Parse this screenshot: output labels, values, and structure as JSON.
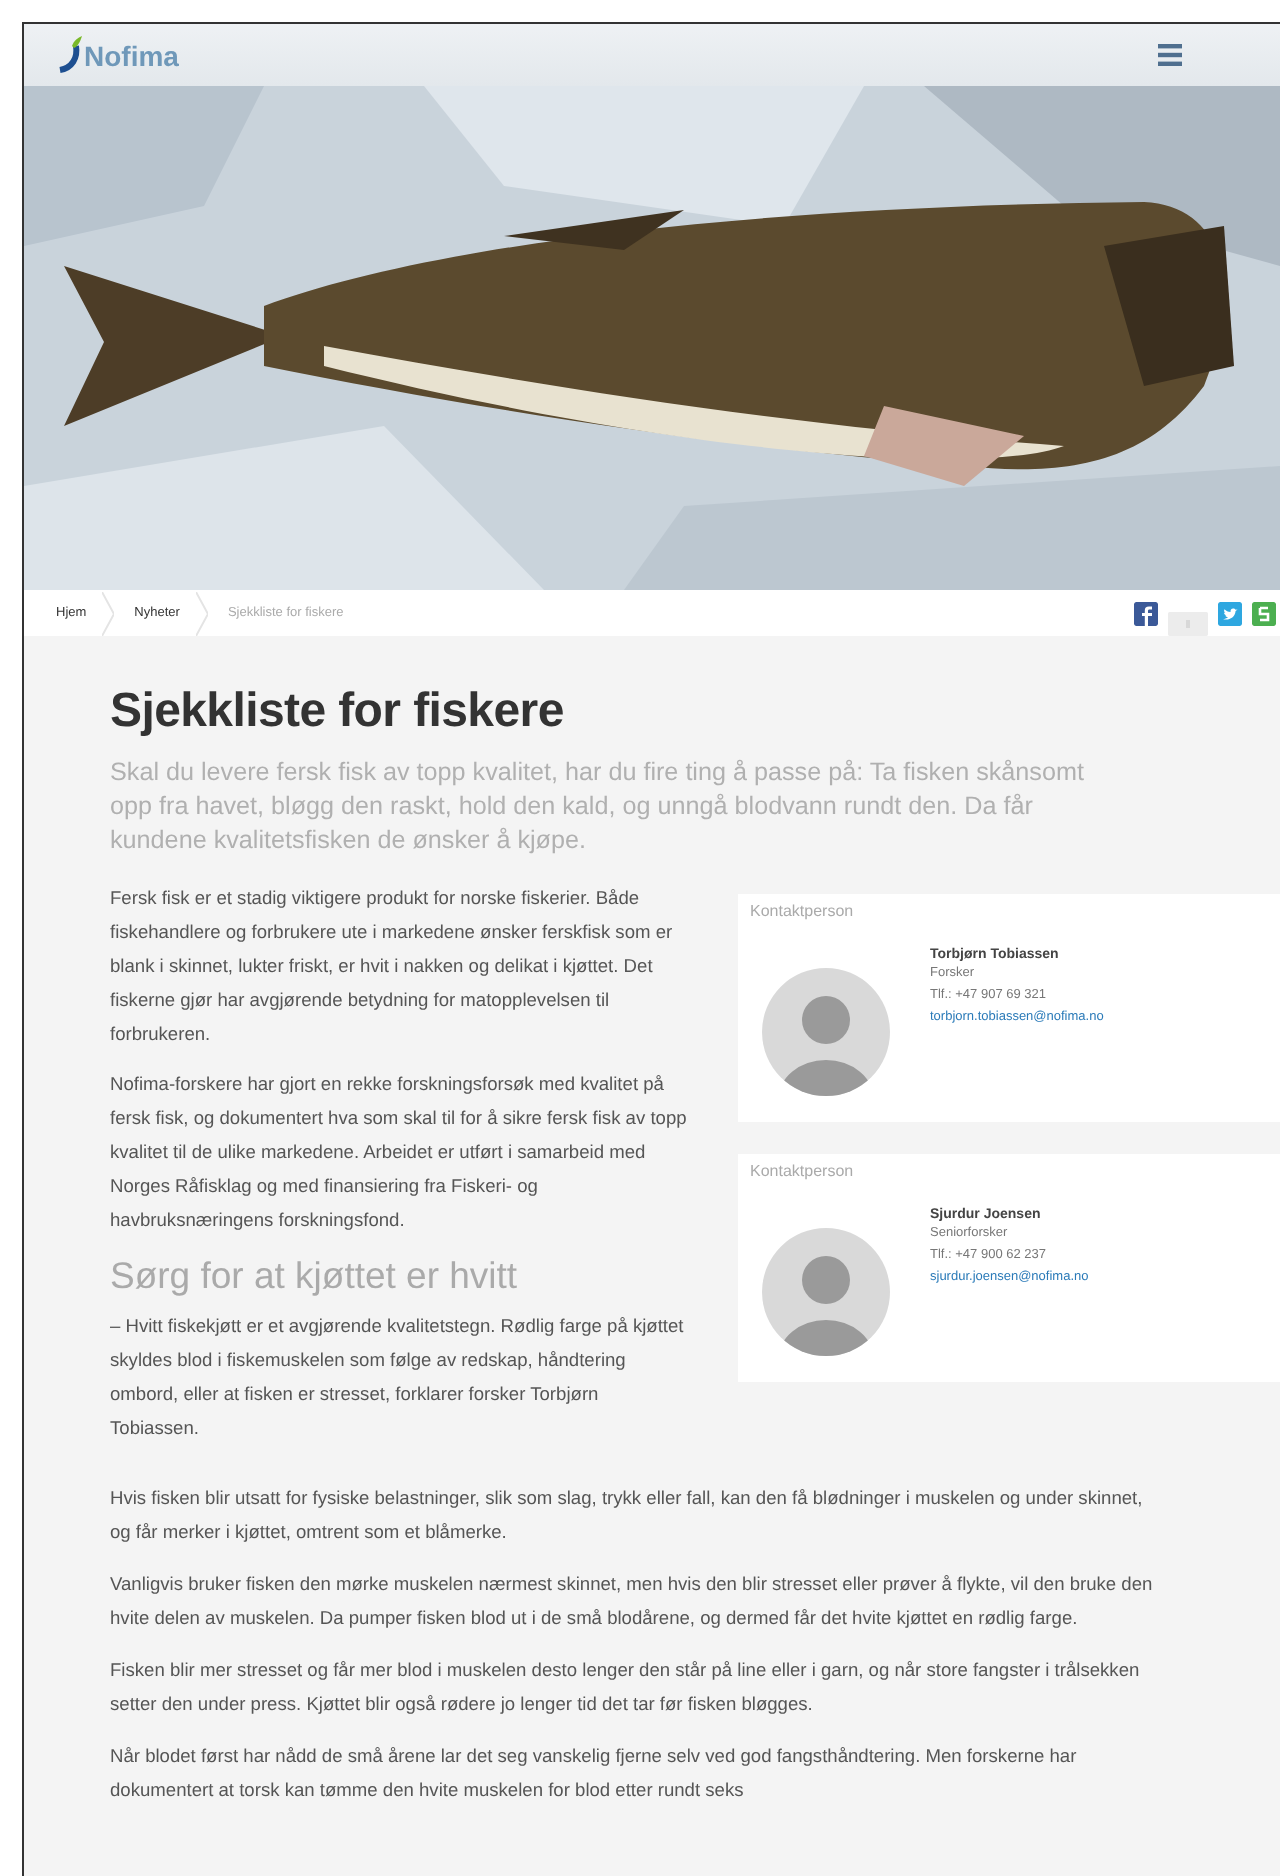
{
  "header": {
    "logo": "Nofima"
  },
  "breadcrumb": [
    {
      "label": "Hjem",
      "current": false
    },
    {
      "label": "Nyheter",
      "current": false
    },
    {
      "label": "Sjekkliste for fiskere",
      "current": true
    }
  ],
  "share": [
    {
      "kind": "facebook"
    },
    {
      "kind": "blank"
    },
    {
      "kind": "twitter"
    },
    {
      "kind": "share"
    }
  ],
  "article": {
    "title": "Sjekkliste for fiskere",
    "lead": "Skal du levere fersk fisk av topp kvalitet, har du fire ting å passe på: Ta fisken skånsomt opp fra havet, bløgg den raskt, hold den kald, og unngå blodvann rundt den. Da får kundene kvalitetsfisken de ønsker å kjøpe.",
    "column_blocks": [
      {
        "kind": "p",
        "text": "Fersk fisk er et stadig viktigere produkt for norske fiskerier. Både fiskehandlere og forbrukere ute i markedene ønsker ferskfisk som er blank i skinnet, lukter friskt, er hvit i nakken og delikat i kjøttet. Det fiskerne gjør har avgjørende betydning for matopplevelsen til forbrukeren."
      },
      {
        "kind": "p",
        "text": "Nofima-forskere har gjort en rekke forskningsforsøk med kvalitet på fersk fisk, og dokumentert hva som skal til for å sikre fersk fisk av topp kvalitet til de ulike markedene. Arbeidet er utført i samarbeid med Norges Råfisklag og med finansiering fra Fiskeri- og havbruksnæringens forskningsfond."
      },
      {
        "kind": "h2",
        "text": "Sørg for at kjøttet er hvitt"
      },
      {
        "kind": "p",
        "text": "– Hvitt fiskekjøtt er et avgjørende kvalitetstegn. Rødlig farge på kjøttet skyldes blod i fiskemuskelen som følge av redskap, håndtering ombord, eller at fisken er stresset, forklarer forsker Torbjørn Tobiassen."
      }
    ],
    "wide_paragraphs": [
      "Hvis fisken blir utsatt for fysiske belastninger, slik som slag, trykk eller fall, kan den få blødninger i muskelen og under skinnet, og får merker i kjøttet, omtrent som et blåmerke.",
      "Vanligvis bruker fisken den mørke muskelen nærmest skinnet, men hvis den blir stresset eller prøver å flykte, vil den bruke den hvite delen av muskelen. Da pumper fisken blod ut i de små blodårene, og dermed får det hvite kjøttet en rødlig farge.",
      "Fisken blir mer stresset og får mer blod i muskelen desto lenger den står på line eller i garn, og når store fangster i trålsekken setter den under press. Kjøttet blir også rødere jo lenger tid det tar før fisken bløgges.",
      "Når blodet først har nådd de små årene lar det seg vanskelig fjerne selv ved god fangsthåndtering. Men forskerne har dokumentert at torsk kan tømme den hvite muskelen for blod etter rundt seks"
    ]
  },
  "contacts": [
    {
      "label": "Kontaktperson",
      "name": "Torbjørn Tobiassen",
      "role": "Forsker",
      "phone": "Tlf.: +47 907 69 321",
      "email": "torbjorn.tobiassen@nofima.no"
    },
    {
      "label": "Kontaktperson",
      "name": "Sjurdur Joensen",
      "role": "Seniorforsker",
      "phone": "Tlf.: +47 900 62 237",
      "email": "sjurdur.joensen@nofima.no"
    }
  ]
}
